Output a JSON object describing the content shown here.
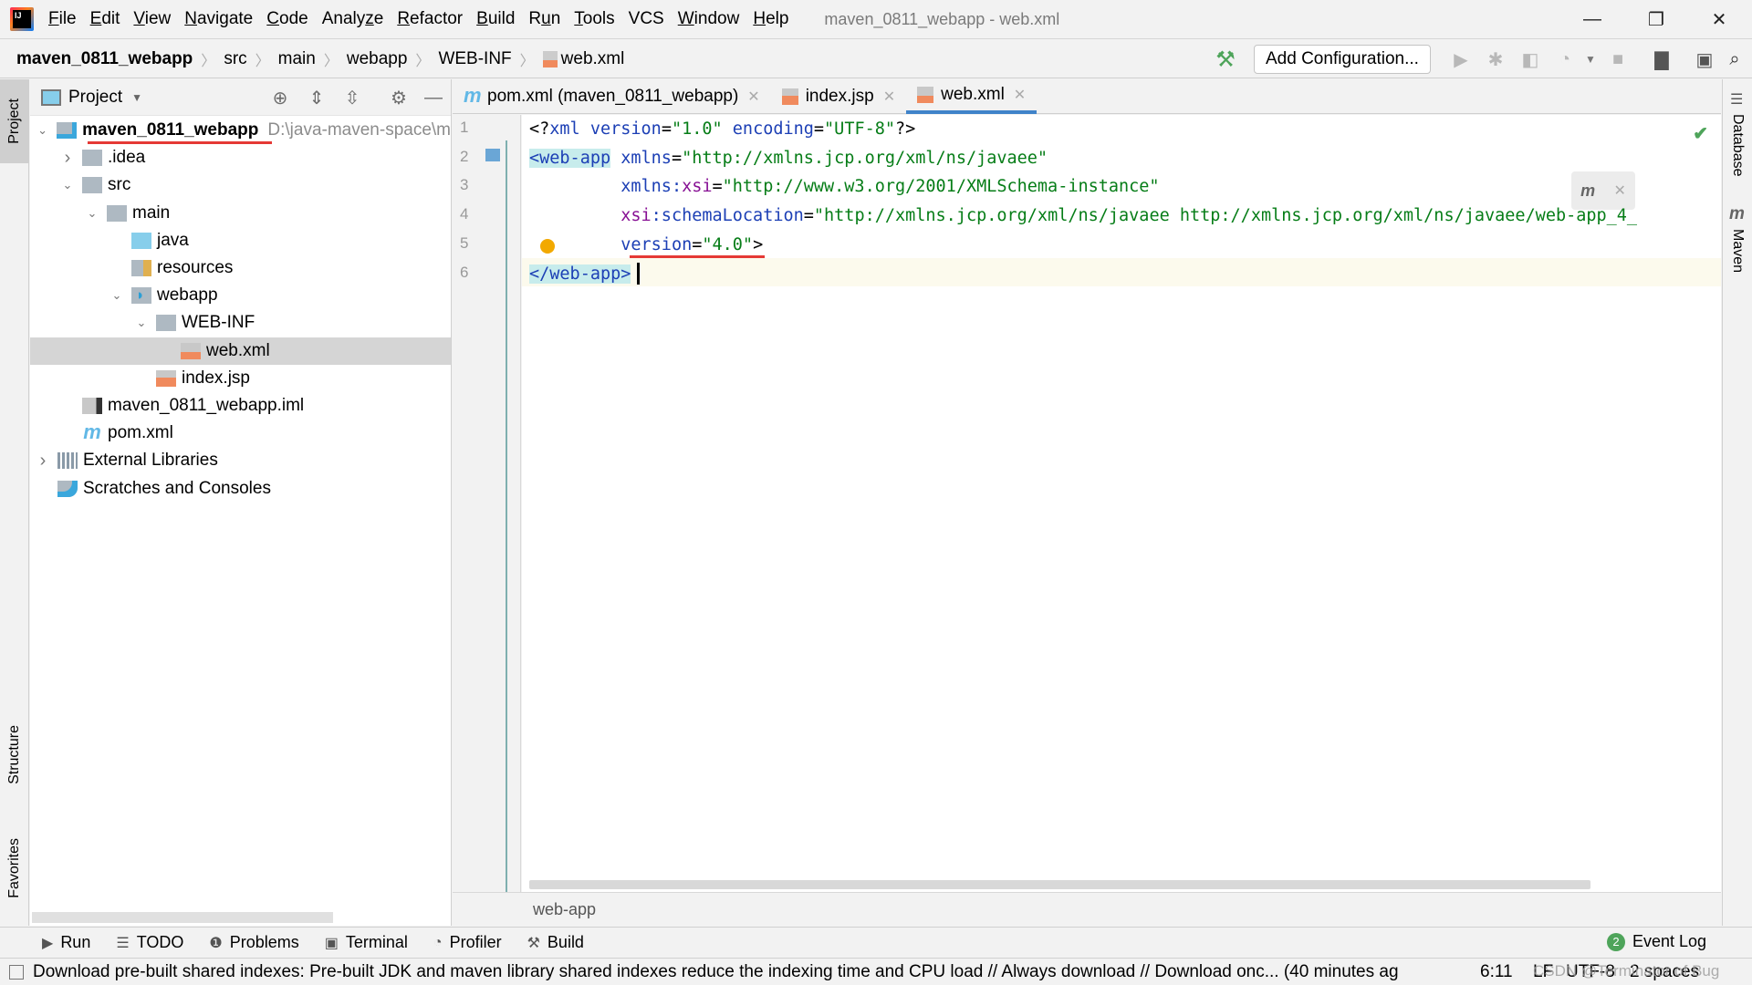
{
  "window": {
    "title": "maven_0811_webapp - web.xml",
    "logo_text": "IJ",
    "controls": {
      "minimize": "—",
      "restore": "❐",
      "close": "✕"
    }
  },
  "menu": [
    {
      "label": "File",
      "mnemonic": "F"
    },
    {
      "label": "Edit",
      "mnemonic": "E"
    },
    {
      "label": "View",
      "mnemonic": "V"
    },
    {
      "label": "Navigate",
      "mnemonic": "N"
    },
    {
      "label": "Code",
      "mnemonic": "C"
    },
    {
      "label": "Analyze",
      "mnemonic": "z"
    },
    {
      "label": "Refactor",
      "mnemonic": "R"
    },
    {
      "label": "Build",
      "mnemonic": "B"
    },
    {
      "label": "Run",
      "mnemonic": "u"
    },
    {
      "label": "Tools",
      "mnemonic": "T"
    },
    {
      "label": "VCS",
      "mnemonic": ""
    },
    {
      "label": "Window",
      "mnemonic": "W"
    },
    {
      "label": "Help",
      "mnemonic": "H"
    }
  ],
  "navbar": {
    "breadcrumbs": [
      "maven_0811_webapp",
      "src",
      "main",
      "webapp",
      "WEB-INF",
      "web.xml"
    ],
    "add_configuration": "Add Configuration...",
    "icons": [
      "hammer-icon",
      "run-icon",
      "debug-icon",
      "coverage-icon",
      "profile-icon",
      "stop-icon",
      "project-structure-icon",
      "run-anything-icon",
      "search-icon"
    ]
  },
  "left_stripe": {
    "project": "Project",
    "structure": "Structure",
    "favorites": "Favorites"
  },
  "project_panel": {
    "title": "Project",
    "tree": [
      {
        "label": "maven_0811_webapp",
        "path": "D:\\java-maven-space\\m",
        "depth": 0,
        "expanded": true,
        "icon": "module-folder",
        "bold": true
      },
      {
        "label": ".idea",
        "depth": 1,
        "expanded": false,
        "icon": "folder"
      },
      {
        "label": "src",
        "depth": 1,
        "expanded": true,
        "icon": "folder"
      },
      {
        "label": "main",
        "depth": 2,
        "expanded": true,
        "icon": "folder"
      },
      {
        "label": "java",
        "depth": 3,
        "icon": "source-folder"
      },
      {
        "label": "resources",
        "depth": 3,
        "icon": "resources-folder"
      },
      {
        "label": "webapp",
        "depth": 3,
        "expanded": true,
        "icon": "web-folder"
      },
      {
        "label": "WEB-INF",
        "depth": 4,
        "expanded": true,
        "icon": "folder"
      },
      {
        "label": "web.xml",
        "depth": 5,
        "icon": "xml-file",
        "selected": true
      },
      {
        "label": "index.jsp",
        "depth": 4,
        "icon": "jsp-file"
      },
      {
        "label": "maven_0811_webapp.iml",
        "depth": 1,
        "icon": "iml-file"
      },
      {
        "label": "pom.xml",
        "depth": 1,
        "icon": "maven-file"
      },
      {
        "label": "External Libraries",
        "depth": 0,
        "expanded": false,
        "icon": "libraries"
      },
      {
        "label": "Scratches and Consoles",
        "depth": 0,
        "icon": "scratches"
      }
    ]
  },
  "editor": {
    "tabs": [
      {
        "label": "pom.xml (maven_0811_webapp)",
        "icon": "maven-file",
        "active": false
      },
      {
        "label": "index.jsp",
        "icon": "jsp-file",
        "active": false
      },
      {
        "label": "web.xml",
        "icon": "xml-file",
        "active": true
      }
    ],
    "line_numbers": [
      "1",
      "2",
      "3",
      "4",
      "5",
      "6"
    ],
    "lines": [
      [
        {
          "t": "<?",
          "c": "plain"
        },
        {
          "t": "xml ",
          "c": "tag"
        },
        {
          "t": "version",
          "c": "attr"
        },
        {
          "t": "=",
          "c": "plain"
        },
        {
          "t": "\"1.0\"",
          "c": "val"
        },
        {
          "t": " ",
          "c": "plain"
        },
        {
          "t": "encoding",
          "c": "attr"
        },
        {
          "t": "=",
          "c": "plain"
        },
        {
          "t": "\"UTF-8\"",
          "c": "val"
        },
        {
          "t": "?>",
          "c": "plain"
        }
      ],
      [
        {
          "t": "<web-app",
          "c": "tag hl"
        },
        {
          "t": " ",
          "c": "plain"
        },
        {
          "t": "xmlns",
          "c": "attr"
        },
        {
          "t": "=",
          "c": "plain"
        },
        {
          "t": "\"http://xmlns.jcp.org/xml/ns/javaee\"",
          "c": "val"
        }
      ],
      [
        {
          "t": "         ",
          "c": "plain"
        },
        {
          "t": "xmlns:",
          "c": "attr"
        },
        {
          "t": "xsi",
          "c": "ns"
        },
        {
          "t": "=",
          "c": "plain"
        },
        {
          "t": "\"http://www.w3.org/2001/XMLSchema-instance\"",
          "c": "val"
        }
      ],
      [
        {
          "t": "         ",
          "c": "plain"
        },
        {
          "t": "xsi",
          "c": "ns"
        },
        {
          "t": ":schemaLocation",
          "c": "attr"
        },
        {
          "t": "=",
          "c": "plain"
        },
        {
          "t": "\"http://xmlns.jcp.org/xml/ns/javaee http://xmlns.jcp.org/xml/ns/javaee/web-app_4_",
          "c": "val"
        }
      ],
      [
        {
          "t": "         ",
          "c": "plain"
        },
        {
          "t": "version",
          "c": "attr"
        },
        {
          "t": "=",
          "c": "plain"
        },
        {
          "t": "\"4.0\"",
          "c": "val"
        },
        {
          "t": ">",
          "c": "plain"
        }
      ],
      [
        {
          "t": "</web-app>",
          "c": "tag hl"
        }
      ]
    ],
    "footer_breadcrumb": "web-app",
    "inspection_status": "ok"
  },
  "right_stripe": {
    "database": "Database",
    "maven": "Maven"
  },
  "tool_windows": [
    {
      "label": "Run",
      "icon": "run-icon"
    },
    {
      "label": "TODO",
      "icon": "todo-icon"
    },
    {
      "label": "Problems",
      "icon": "problems-icon"
    },
    {
      "label": "Terminal",
      "icon": "terminal-icon"
    },
    {
      "label": "Profiler",
      "icon": "profiler-icon"
    },
    {
      "label": "Build",
      "icon": "build-icon"
    }
  ],
  "event_log": {
    "label": "Event Log",
    "count": "2"
  },
  "status_bar": {
    "message": "Download pre-built shared indexes: Pre-built JDK and maven library shared indexes reduce the indexing time and CPU load // Always download // Download onc... (40 minutes ag",
    "position": "6:11",
    "line_separator": "LF",
    "encoding": "UTF-8",
    "indent": "2 spaces",
    "watermark": "CSDN @Terminator of Bug"
  },
  "colors": {
    "accent": "#4083c9",
    "annotation_red": "#e53935",
    "xml_tag": "#1c3fb5",
    "xml_value": "#067d17",
    "xml_ns": "#871094"
  }
}
